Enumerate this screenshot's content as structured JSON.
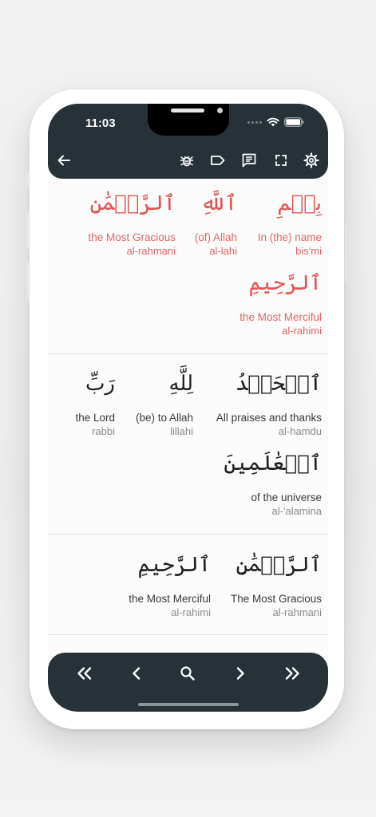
{
  "status": {
    "time": "11:03"
  },
  "toolbar": {
    "icons": [
      "back-arrow-icon",
      "bug-icon",
      "label-icon",
      "comment-list-icon",
      "fullscreen-icon",
      "gear-icon"
    ]
  },
  "verses": [
    {
      "words": [
        {
          "arabic": "بِسۡمِ",
          "english": "In (the) name",
          "translit": "bis'mi"
        },
        {
          "arabic": "ٱللَّهِ",
          "english": "(of) Allah",
          "translit": "al-lahi"
        },
        {
          "arabic": "ٱلرَّحۡمَٰنِ",
          "english": "the Most Gracious",
          "translit": "al-rahmani"
        },
        {
          "arabic": "ٱلرَّحِيمِ",
          "english": "the Most Merciful",
          "translit": "al-rahimi"
        }
      ]
    },
    {
      "words": [
        {
          "arabic": "ٱلۡحَمۡدُ",
          "english": "All praises and thanks",
          "translit": "al-hamdu"
        },
        {
          "arabic": "لِلَّهِ",
          "english": "(be) to Allah",
          "translit": "lillahi"
        },
        {
          "arabic": "رَبِّ",
          "english": "the Lord",
          "translit": "rabbi"
        },
        {
          "arabic": "ٱلۡعَٰلَمِينَ",
          "english": "of the universe",
          "translit": "al-'alamina"
        }
      ]
    },
    {
      "words": [
        {
          "arabic": "ٱلرَّحۡمَٰنِ",
          "english": "The Most Gracious",
          "translit": "al-rahmani"
        },
        {
          "arabic": "ٱلرَّحِيمِ",
          "english": "the Most Merciful",
          "translit": "al-rahimi"
        }
      ]
    }
  ],
  "bottom_nav": {
    "icons": [
      "first-page-icon",
      "previous-icon",
      "search-icon",
      "next-icon",
      "last-page-icon"
    ]
  },
  "colors": {
    "bar": "#263238",
    "highlight": "#e05454"
  }
}
